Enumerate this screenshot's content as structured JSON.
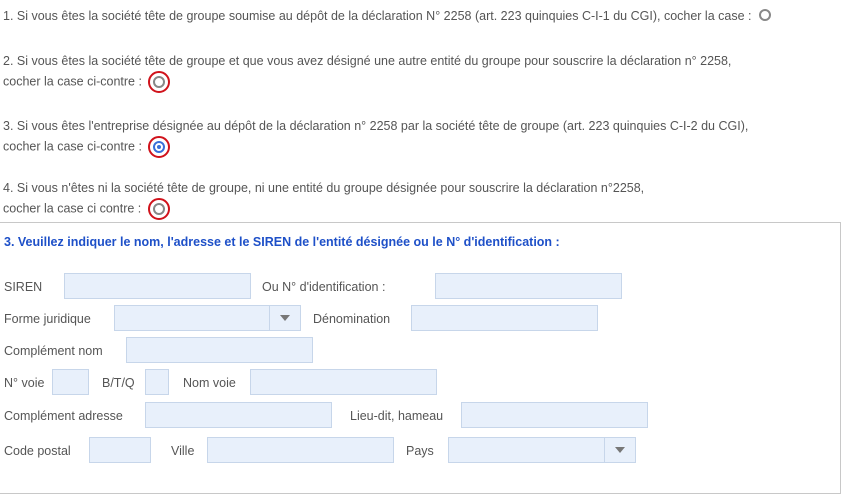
{
  "options": [
    {
      "line1": "1. Si vous êtes la société tête de groupe soumise au dépôt de la déclaration N° 2258 (art. 223 quinquies C-I-1 du CGI), cocher la case :",
      "line2": "",
      "checked": false
    },
    {
      "line1": "2. Si vous êtes la société tête de groupe et que vous avez désigné une autre entité du groupe pour souscrire la déclaration n° 2258,",
      "line2": "cocher la case ci-contre :",
      "checked": false
    },
    {
      "line1": "3. Si vous êtes l'entreprise désignée au dépôt de la déclaration n° 2258 par la société tête de groupe (art. 223 quinquies C-I-2 du CGI),",
      "line2": "cocher la case ci-contre :",
      "checked": true
    },
    {
      "line1": "4. Si vous n'êtes ni la société tête de groupe, ni une entité du groupe désignée pour souscrire la déclaration n°2258,",
      "line2": "cocher la case ci contre :",
      "checked": false
    }
  ],
  "section": {
    "title": "3. Veuillez indiquer le nom, l'adresse et le SIREN de l'entité désignée ou le N° d'identification :",
    "labels": {
      "siren": "SIREN",
      "id_number": "Ou N° d'identification :",
      "forme_juridique": "Forme juridique",
      "denomination": "Dénomination",
      "complement_nom": "Complément nom",
      "num_voie": "N° voie",
      "btq": "B/T/Q",
      "nom_voie": "Nom voie",
      "complement_adresse": "Complément adresse",
      "lieu_dit": "Lieu-dit, hameau",
      "code_postal": "Code postal",
      "ville": "Ville",
      "pays": "Pays"
    },
    "values": {
      "siren": "",
      "id_number": "",
      "forme_juridique": "",
      "denomination": "",
      "complement_nom": "",
      "num_voie": "",
      "btq": "",
      "nom_voie": "",
      "complement_adresse": "",
      "lieu_dit": "",
      "code_postal": "",
      "ville": "",
      "pays": ""
    }
  },
  "colors": {
    "highlight_ring": "#d0121b",
    "radio_checked": "#3a6fd8",
    "title": "#1e50c8",
    "field_bg": "#e8f0fb"
  },
  "icons": {
    "dropdown": "chevron-down-icon",
    "radio": "radio-icon"
  }
}
